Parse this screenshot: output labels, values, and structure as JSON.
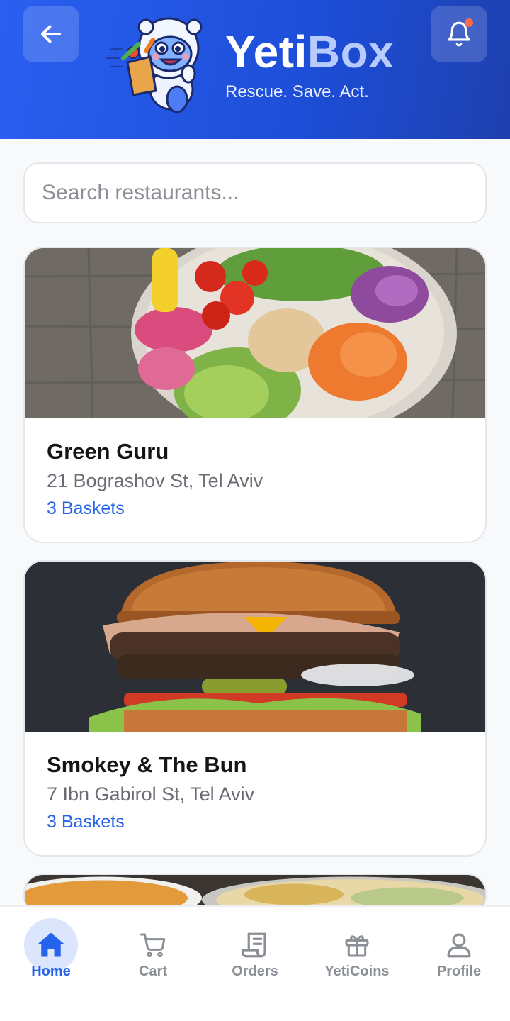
{
  "header": {
    "brand_part1": "Yeti",
    "brand_part2": "Box",
    "tagline": "Rescue. Save. Act.",
    "back_icon": "arrow-left-icon",
    "bell_icon": "bell-icon",
    "has_notification": true
  },
  "search": {
    "placeholder": "Search restaurants..."
  },
  "restaurants": [
    {
      "name": "Green Guru",
      "address": "21 Bograshov St, Tel Aviv",
      "baskets": "3 Baskets",
      "image": "salad-bowl"
    },
    {
      "name": "Smokey & The Bun",
      "address": "7 Ibn Gabirol St, Tel Aviv",
      "baskets": "3 Baskets",
      "image": "burger"
    },
    {
      "name": "",
      "address": "",
      "baskets": "",
      "image": "soup-and-salad"
    }
  ],
  "nav": {
    "active": "home",
    "items": [
      {
        "id": "home",
        "label": "Home",
        "icon": "home-icon"
      },
      {
        "id": "cart",
        "label": "Cart",
        "icon": "cart-icon"
      },
      {
        "id": "orders",
        "label": "Orders",
        "icon": "receipt-icon"
      },
      {
        "id": "coins",
        "label": "YetiCoins",
        "icon": "gift-icon"
      },
      {
        "id": "profile",
        "label": "Profile",
        "icon": "user-icon"
      }
    ]
  },
  "colors": {
    "primary": "#2563eb",
    "header_gradient_start": "#2a5ff0",
    "header_gradient_end": "#1e40af",
    "notification_dot": "#ff6b4a"
  }
}
